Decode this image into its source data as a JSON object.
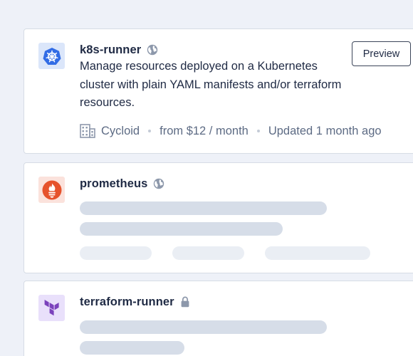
{
  "cards": [
    {
      "name": "k8s-runner",
      "visibility_icon": "globe-icon",
      "description": "Manage resources deployed on a Kubernetes cluster with plain YAML manifests and/or terraform resources.",
      "owner": "Cycloid",
      "price": "from $12 / month",
      "updated": "Updated 1 month ago",
      "action_label": "Preview",
      "logo_icon": "kubernetes-icon",
      "logo_color": "#326ce5"
    },
    {
      "name": "prometheus",
      "visibility_icon": "globe-icon",
      "logo_icon": "prometheus-icon",
      "logo_color": "#e6522c",
      "loading": true
    },
    {
      "name": "terraform-runner",
      "visibility_icon": "lock-icon",
      "logo_icon": "terraform-icon",
      "logo_color": "#7b42bc",
      "loading": true
    }
  ]
}
